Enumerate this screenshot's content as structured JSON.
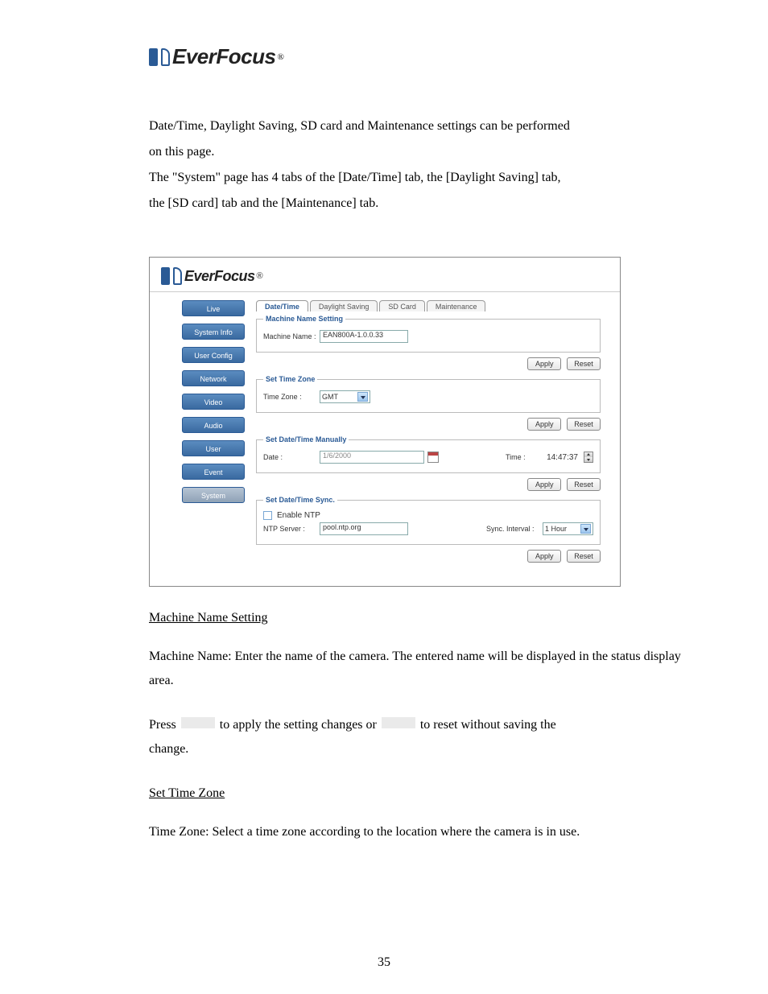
{
  "logo": {
    "brand": "EverFocus",
    "reg": "®"
  },
  "intro": {
    "p1a": "Date/Time, Daylight Saving, SD card and Maintenance settings can be performed",
    "p1b": "on this page.",
    "p2a": "The \"System\" page has 4 tabs of the [Date/Time] tab, the [Daylight Saving] tab,",
    "p2b": "the [SD card] tab and the [Maintenance] tab."
  },
  "nav": {
    "live": "Live",
    "system_info": "System Info",
    "user_config": "User Config",
    "network": "Network",
    "video": "Video",
    "audio": "Audio",
    "user": "User",
    "event": "Event",
    "system": "System"
  },
  "tabs": {
    "datetime": "Date/Time",
    "daylight": "Daylight Saving",
    "sdcard": "SD Card",
    "maintenance": "Maintenance"
  },
  "fs": {
    "machine_name": {
      "legend": "Machine Name Setting",
      "label": "Machine Name :",
      "value": "EAN800A-1.0.0.33"
    },
    "timezone": {
      "legend": "Set Time Zone",
      "label": "Time Zone :",
      "value": "GMT"
    },
    "manual": {
      "legend": "Set Date/Time Manually",
      "date_label": "Date :",
      "date_value": "1/6/2000",
      "time_label": "Time :",
      "time_value": "14:47:37"
    },
    "sync": {
      "legend": "Set Date/Time Sync.",
      "enable": "Enable NTP",
      "server_label": "NTP Server :",
      "server_value": "pool.ntp.org",
      "interval_label": "Sync. Interval :",
      "interval_value": "1 Hour"
    }
  },
  "buttons": {
    "apply": "Apply",
    "reset": "Reset"
  },
  "doc": {
    "h1": "Machine Name Setting",
    "p1": "Machine Name: Enter the name of the camera. The entered name will be displayed in the status display area.",
    "p2a": "Press",
    "p2b": "to apply the setting changes or",
    "p2c": "to reset without saving the",
    "p2d": "change.",
    "h2": "Set Time Zone",
    "p3": "Time Zone: Select a time zone according to the location where the camera is in use."
  },
  "page_number": "35"
}
